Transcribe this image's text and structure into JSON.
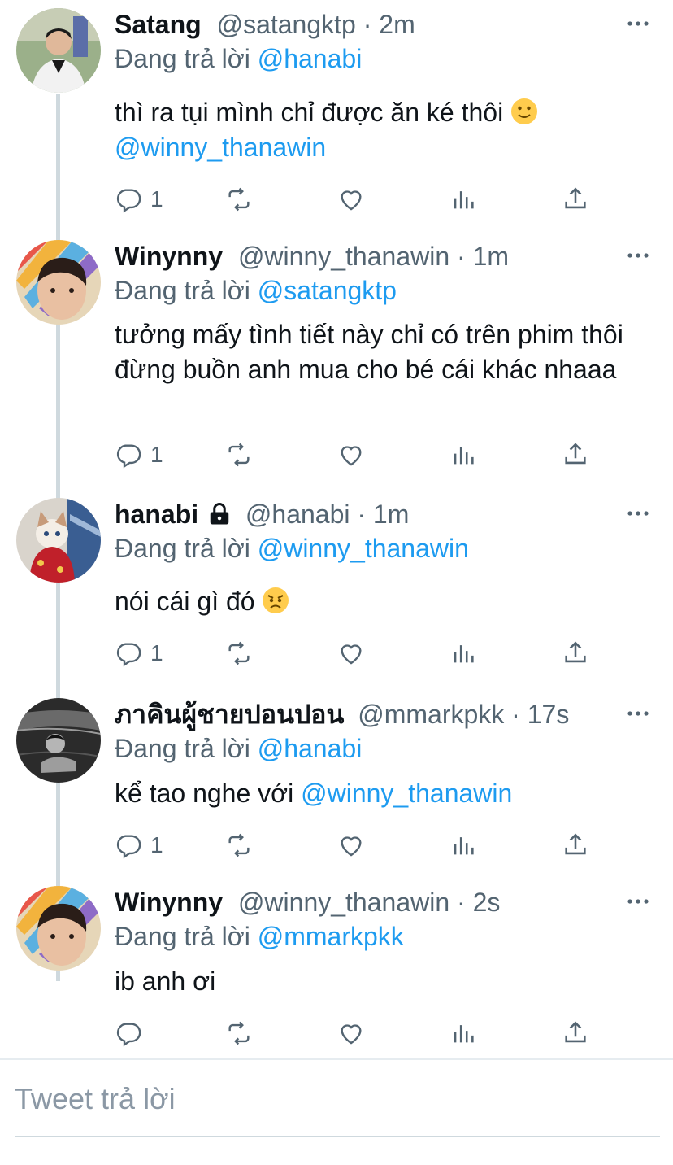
{
  "ui": {
    "replying_prefix": "Đang trả lời",
    "reply_placeholder": "Tweet trả lời",
    "separator": "·"
  },
  "tweets": [
    {
      "name": "Satang",
      "handle": "@satangktp",
      "time": "2m",
      "reply_to": "@hanabi",
      "text": "thì ra tụi mình chỉ được ăn ké thôi",
      "text_emoji": "slightly-smiling-face",
      "text_mention": "@winny_thanawin",
      "reply_count": "1"
    },
    {
      "name": "Winynny",
      "handle": "@winny_thanawin",
      "time": "1m",
      "reply_to": "@satangktp",
      "text": "tưởng mấy tình tiết này chỉ có trên phim thôi đừng buồn anh mua cho bé cái khác nhaaa",
      "reply_count": "1"
    },
    {
      "name": "hanabi",
      "handle": "@hanabi",
      "time": "1m",
      "reply_to": "@winny_thanawin",
      "text": "nói cái gì đó",
      "text_emoji": "angry-face",
      "protected": true,
      "reply_count": "1"
    },
    {
      "name": "ภาคินผู้ชายปอนปอน",
      "handle": "@mmarkpkk",
      "time": "17s",
      "reply_to": "@hanabi",
      "text": "kể tao nghe với",
      "text_mention": "@winny_thanawin",
      "reply_count": "1"
    },
    {
      "name": "Winynny",
      "handle": "@winny_thanawin",
      "time": "2s",
      "reply_to": "@mmarkpkk",
      "text": "ib anh ơi",
      "reply_count": ""
    }
  ],
  "icons": [
    "reply-icon",
    "retweet-icon",
    "like-icon",
    "analytics-icon",
    "share-icon",
    "more-icon",
    "lock-icon"
  ],
  "colors": {
    "link": "#1d9bf0",
    "secondary": "#536471",
    "thread": "#cfd9de"
  }
}
